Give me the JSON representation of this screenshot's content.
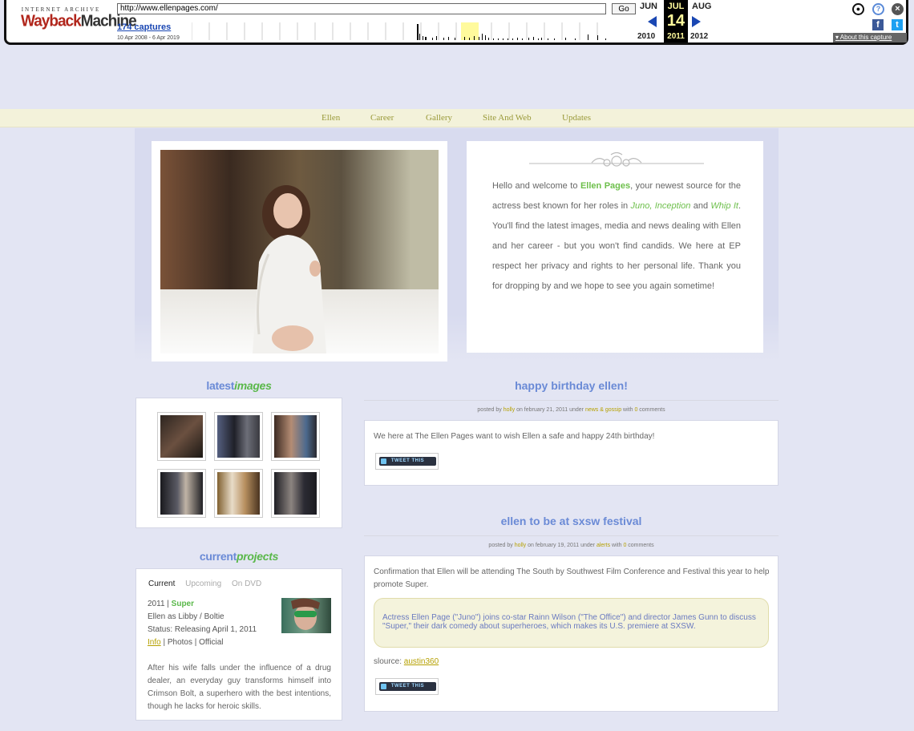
{
  "wayback": {
    "logo_top": "INTERNET ARCHIVE",
    "logo_main_a": "Wayback",
    "logo_main_b": "Machine",
    "url": "http://www.ellenpages.com/",
    "go": "Go",
    "captures": "174 captures",
    "range": "10 Apr 2008 - 6 Apr 2019",
    "prev_month": "JUN",
    "cur_month": "JUL",
    "next_month": "AUG",
    "day": "14",
    "prev_year": "2010",
    "cur_year": "2011",
    "next_year": "2012",
    "about": "About this capture",
    "icons": [
      "user-icon",
      "help-icon",
      "close-icon",
      "facebook-icon",
      "twitter-icon"
    ],
    "colors": {
      "accent": "#1a47b3",
      "logo": "#b1261c",
      "highlight": "#fffa9c"
    }
  },
  "nav": {
    "items": [
      "Ellen",
      "Career",
      "Gallery",
      "Site And Web",
      "Updates"
    ]
  },
  "welcome": {
    "t1": "Hello and welcome to ",
    "name": "Ellen Pages",
    "t2": ", your newest source for the actress best known for her roles in ",
    "m1": "Juno",
    "sep": ", ",
    "m2": "Inception",
    "t3": " and ",
    "m3": "Whip It",
    "t4": ". You'll find the latest images, media and news dealing with Ellen and her career - but you won't find candids. We here at EP respect her privacy and rights to her personal life. Thank you for dropping by and we hope to see you again sometime!"
  },
  "latest_images": {
    "title_a": "latest",
    "title_b": "images",
    "count": 6
  },
  "current_projects": {
    "title_a": "current",
    "title_b": "projects",
    "tabs": [
      "Current",
      "Upcoming",
      "On DVD"
    ],
    "year": "2011 | ",
    "film": "Super",
    "role": "Ellen as Libby / Boltie",
    "status": "Status: Releasing April 1, 2011",
    "info": "Info",
    "links_rest": " | Photos | Official",
    "description": "After his wife falls under the influence of a drug dealer, an everyday guy transforms himself into Crimson Bolt, a superhero with the best intentions, though he lacks for heroic skills."
  },
  "posts": [
    {
      "title": "happy birthday ellen!",
      "meta_a": "posted by ",
      "author": "holly",
      "meta_b": " on february 21, 2011 under ",
      "category": "news & gossip",
      "meta_c": " with ",
      "comments": "0",
      "meta_d": " comments",
      "body": "We here at The Ellen Pages want to wish Ellen a safe and happy 24th birthday!",
      "tweet": "TWEET THIS"
    },
    {
      "title": "ellen to be at sxsw festival",
      "meta_a": "posted by ",
      "author": "holly",
      "meta_b": " on february 19, 2011 under ",
      "category": "alerts",
      "meta_c": " with ",
      "comments": "0",
      "meta_d": " comments",
      "body": "Confirmation that Ellen will be attending The South by Southwest Film Conference and Festival this year to help promote Super.",
      "quote": "Actress Ellen Page (\"Juno\") joins co-star Rainn Wilson (\"The Office\") and director James Gunn to discuss \"Super,\" their dark comedy about superheroes, which makes its U.S. premiere at SXSW.",
      "source_label": "slource: ",
      "source_link": "austin360",
      "tweet": "TWEET THIS"
    }
  ]
}
